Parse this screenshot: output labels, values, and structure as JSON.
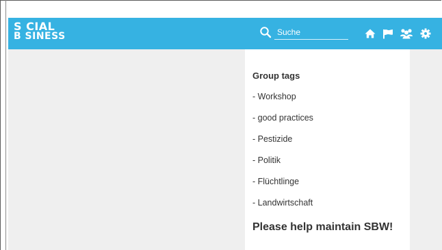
{
  "header": {
    "logo_line1": "S  CIAL",
    "logo_line2": "B SINESS",
    "logo_alt": "SOCIAL BUSINESS",
    "search_placeholder": "Suche",
    "icons": [
      "search-icon",
      "home-icon",
      "flag-icon",
      "group-icon",
      "gear-icon"
    ],
    "bar_color": "#36b2e2"
  },
  "sidebar": {
    "tags_title": "Group tags",
    "tags": [
      "- Workshop",
      "- good practices",
      "- Pestizide",
      "- Politik",
      "- Flüchtlinge",
      "- Landwirtschaft"
    ],
    "help_title": "Please help maintain SBW!"
  }
}
